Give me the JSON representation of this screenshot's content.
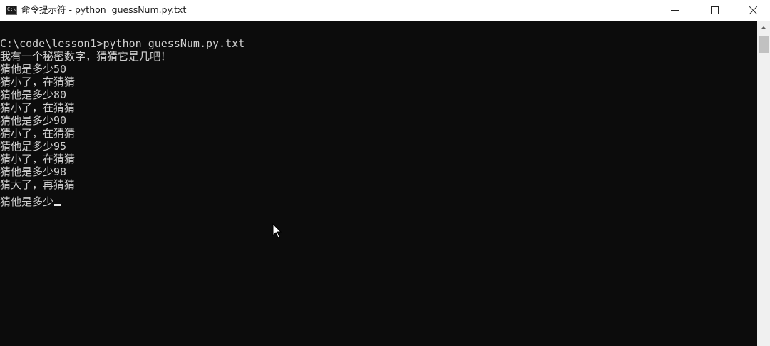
{
  "window": {
    "title": "命令提示符 - python  guessNum.py.txt",
    "icon": "cmd-icon",
    "controls": {
      "minimize": "minimize-icon",
      "maximize": "maximize-icon",
      "close": "close-icon"
    }
  },
  "console": {
    "lines": [
      "C:\\code\\lesson1>python guessNum.py.txt",
      "我有一个秘密数字，猜猜它是几吧！",
      "猜他是多少50",
      "猜小了，在猜猜",
      "猜他是多少80",
      "猜小了，在猜猜",
      "猜他是多少90",
      "猜小了，在猜猜",
      "猜他是多少95",
      "猜小了，在猜猜",
      "猜他是多少98",
      "猜大了，再猜猜",
      "猜他是多少"
    ]
  },
  "colors": {
    "console_bg": "#0c0c0c",
    "console_text": "#cfcfcf",
    "titlebar_bg": "#ffffff",
    "scrollbar_bg": "#f0f0f0",
    "scroll_thumb": "#c1c1c1"
  }
}
